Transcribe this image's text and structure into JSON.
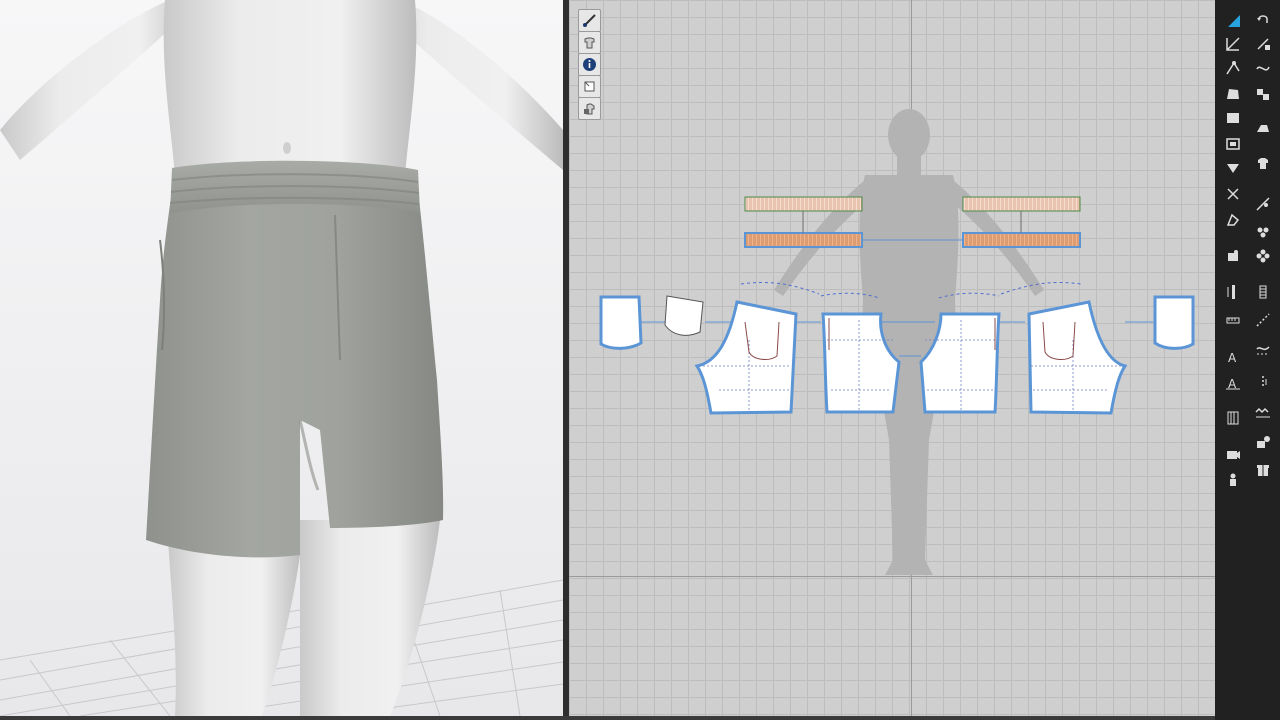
{
  "app": {
    "panels": [
      "3d-garment-window",
      "2d-pattern-window"
    ]
  },
  "colors": {
    "garment": "#9a9d98",
    "pattern_fill": "#ffffff",
    "pattern_outline": "#5b95d6",
    "waistband": "#f0b38a",
    "waistband_light": "#f6dccd",
    "toolbar_bg": "#212121",
    "grid_bg": "#cfcfcf"
  },
  "view_tools": [
    {
      "icon": "brush-icon"
    },
    {
      "icon": "eye-shirt-icon"
    },
    {
      "icon": "info-icon"
    },
    {
      "icon": "fabric-icon"
    },
    {
      "icon": "lock-shirt-icon"
    }
  ],
  "toolbar_left": [
    {
      "icon": "select-arrow-icon",
      "active": true
    },
    {
      "icon": "transform-icon"
    },
    {
      "icon": "edit-point-icon"
    },
    {
      "icon": "polygon-icon"
    },
    {
      "icon": "rectangle-icon"
    },
    {
      "icon": "internal-shape-icon"
    },
    {
      "icon": "dart-icon"
    },
    {
      "icon": "cut-icon"
    },
    {
      "icon": "fold-icon"
    },
    {
      "icon": "pin-icon"
    },
    {
      "icon": "ruler-icon"
    },
    {
      "icon": "measure-icon"
    },
    {
      "icon": "text-icon"
    },
    {
      "icon": "text-edit-icon"
    },
    {
      "icon": "grade-icon"
    },
    {
      "icon": "camera-icon"
    },
    {
      "icon": "avatar-icon"
    }
  ],
  "toolbar_right": [
    {
      "icon": "undo-icon"
    },
    {
      "icon": "sewing-segment-icon"
    },
    {
      "icon": "sewing-free-icon"
    },
    {
      "icon": "sewing-multi-icon"
    },
    {
      "icon": "iron-icon"
    },
    {
      "icon": "shirt-icon"
    },
    {
      "icon": "puckering-icon"
    },
    {
      "icon": "tack-icon"
    },
    {
      "icon": "button-icon"
    },
    {
      "icon": "zipper-icon"
    },
    {
      "icon": "stitch-icon"
    },
    {
      "icon": "curve-icon"
    },
    {
      "icon": "topstitch-icon"
    },
    {
      "icon": "wave-stitch-icon"
    },
    {
      "icon": "trim-icon"
    },
    {
      "icon": "gift-icon"
    }
  ]
}
